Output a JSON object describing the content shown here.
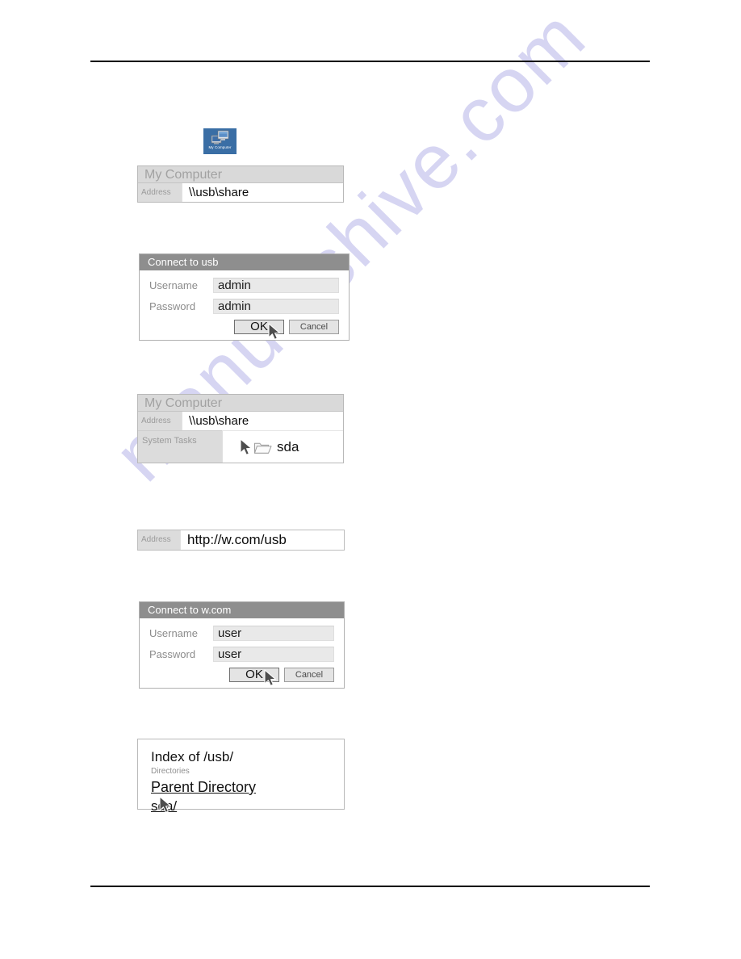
{
  "page": {
    "watermark_text": "manualshive.com",
    "watermark_color": "#d4d3f2",
    "rule_color": "#000000",
    "background": "#ffffff"
  },
  "desktop_icon": {
    "caption": "My Computer",
    "icon": "my-computer-icon",
    "selected_background": "#3a6ea5"
  },
  "explorer_step1": {
    "title": "My Computer",
    "address_label": "Address",
    "address_value": "\\\\usb\\share"
  },
  "dialog_usb": {
    "title": "Connect to usb",
    "username_label": "Username",
    "username_value": "admin",
    "password_label": "Password",
    "password_value": "admin",
    "ok_label": "OK",
    "cancel_label": "Cancel",
    "cursor": "arrow-cursor"
  },
  "explorer_step2": {
    "title": "My Computer",
    "address_label": "Address",
    "address_value": "\\\\usb\\share",
    "tasks_label": "System Tasks",
    "folder_icon": "folder-icon",
    "folder_name": "sda",
    "cursor": "arrow-cursor"
  },
  "addressbar_web": {
    "address_label": "Address",
    "address_value": "http://w.com/usb"
  },
  "dialog_web": {
    "title": "Connect to w.com",
    "username_label": "Username",
    "username_value": "user",
    "password_label": "Password",
    "password_value": "user",
    "ok_label": "OK",
    "cancel_label": "Cancel",
    "cursor": "arrow-cursor"
  },
  "listing": {
    "heading": "Index of  /usb/",
    "subheading": "Directories",
    "parent_link": "Parent Directory",
    "dir_link": "sda/",
    "cursor": "arrow-cursor"
  }
}
